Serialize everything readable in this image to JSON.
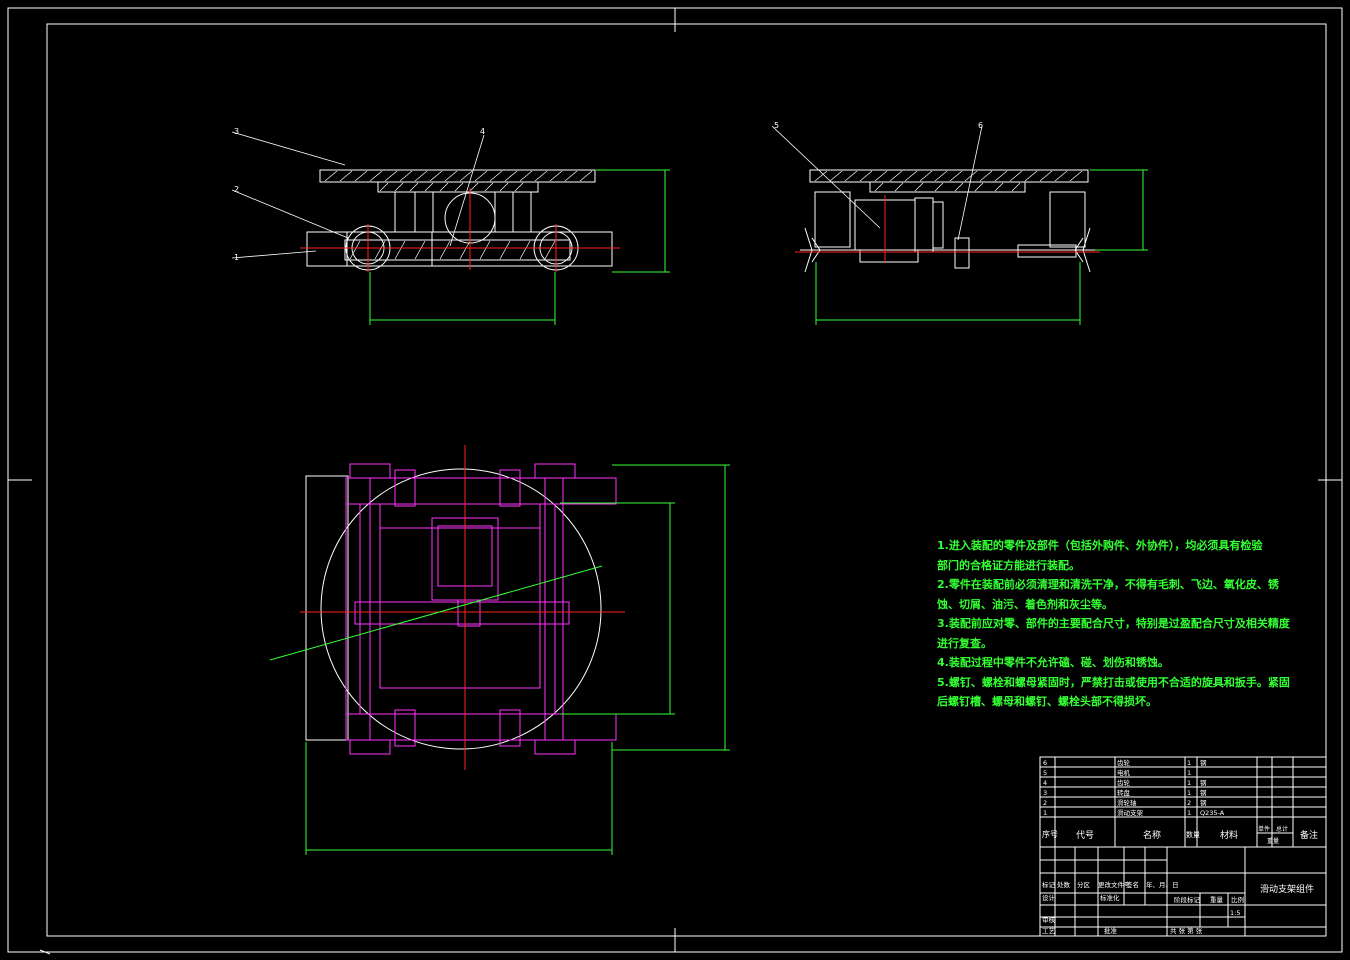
{
  "notes": [
    "1.进入装配的零件及部件（包括外购件、外协件），均必须具有检验",
    "部门的合格证方能进行装配。",
    "2.零件在装配前必须清理和清洗干净，不得有毛刺、飞边、氧化皮、锈",
    "蚀、切屑、油污、着色剂和灰尘等。",
    "3.装配前应对零、部件的主要配合尺寸，特别是过盈配合尺寸及相关精度",
    "进行复查。",
    "4.装配过程中零件不允许磕、碰、划伤和锈蚀。",
    "5.螺钉、螺栓和螺母紧固时，严禁打击或使用不合适的旋具和扳手。紧固",
    "后螺钉槽、螺母和螺钉、螺栓头部不得损坏。"
  ],
  "balloons": {
    "b1": "1",
    "b2": "2",
    "b3": "3",
    "b4": "4",
    "b5": "5",
    "b6": "6"
  },
  "bom": {
    "headers": {
      "seq": "序号",
      "code": "代号",
      "name": "名称",
      "qty": "数量",
      "material": "材料",
      "unit_weight": "单件",
      "total_weight": "总计",
      "weight": "重量",
      "remark": "备注"
    },
    "rows": [
      {
        "seq": "6",
        "name": "齿轮",
        "qty": "1",
        "mat": "钢"
      },
      {
        "seq": "5",
        "name": "电机",
        "qty": "1",
        "mat": ""
      },
      {
        "seq": "4",
        "name": "齿轮",
        "qty": "1",
        "mat": "钢"
      },
      {
        "seq": "3",
        "name": "转盘",
        "qty": "1",
        "mat": "钢"
      },
      {
        "seq": "2",
        "name": "滑轮轴",
        "qty": "2",
        "mat": "钢"
      },
      {
        "seq": "1",
        "name": "滑动支架",
        "qty": "1",
        "mat": "Q235-A"
      }
    ]
  },
  "titleblock": {
    "drawing_title": "滑动支架组件",
    "mark": "标记",
    "count": "处数",
    "zone": "分区",
    "change_doc": "更改文件号",
    "sign": "签名",
    "date": "年、月、日",
    "design": "设计",
    "standardize": "标准化",
    "stage_mark": "阶段标记",
    "weight": "重量",
    "scale": "比例",
    "scale_value": "1:5",
    "check": "审核",
    "process": "工艺",
    "approve": "批准",
    "sheets": "共  张  第  张"
  }
}
